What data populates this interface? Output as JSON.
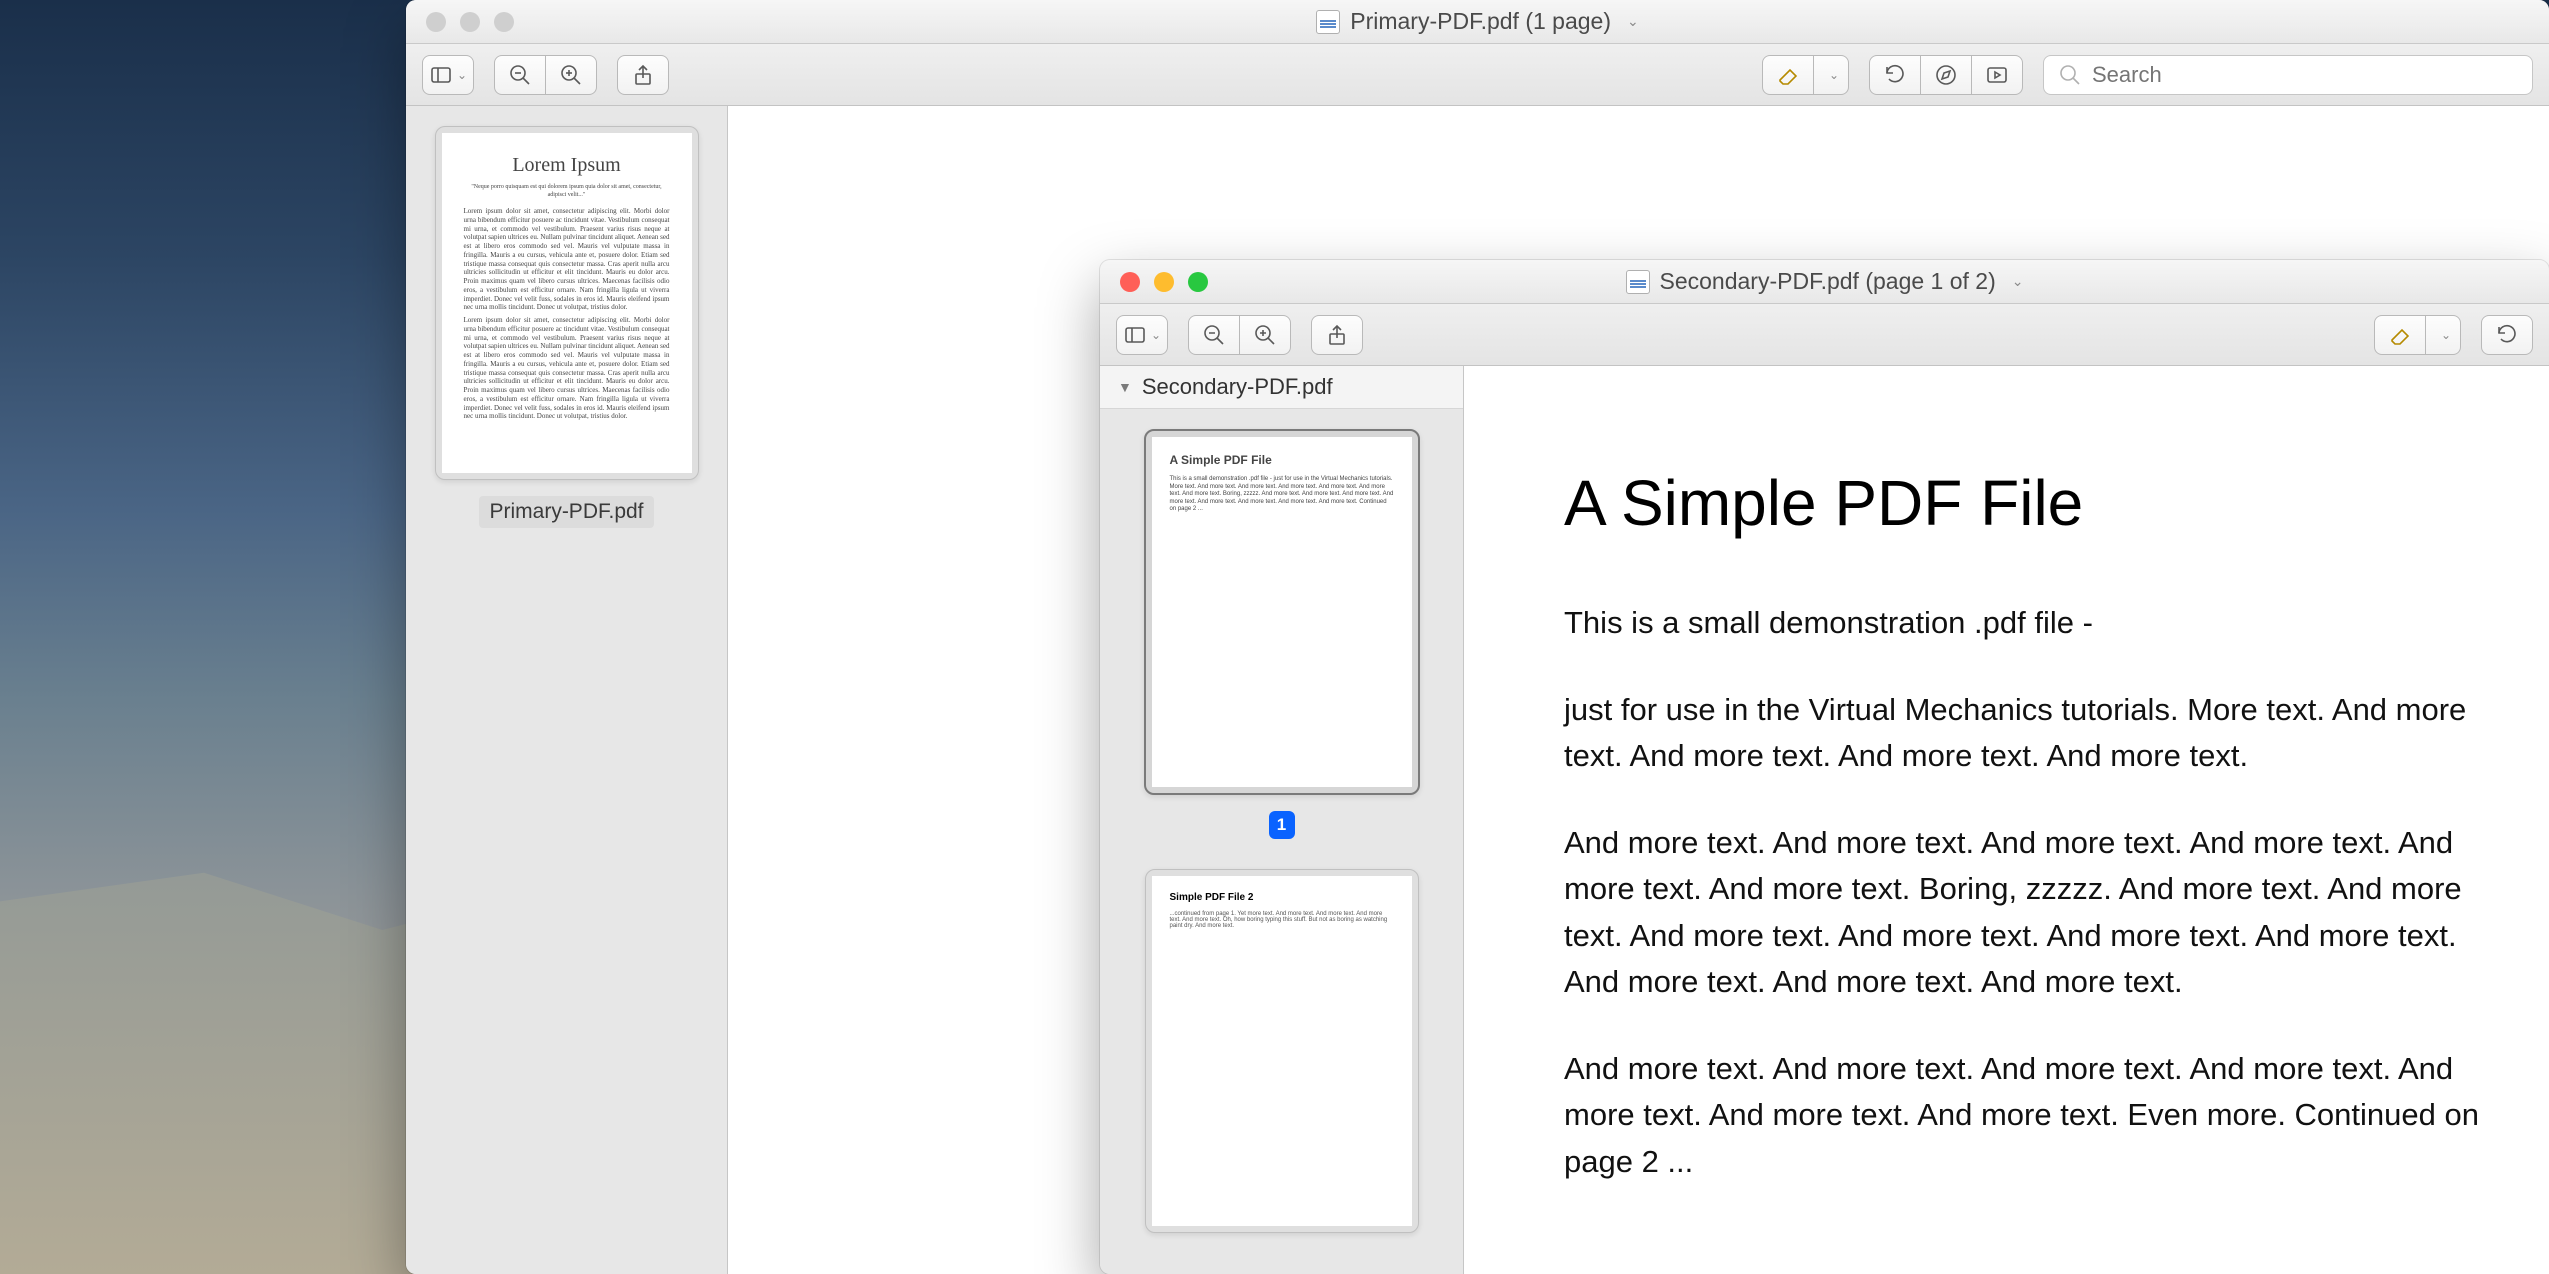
{
  "windows": {
    "primary": {
      "title": "Primary-PDF.pdf (1 page)",
      "search_placeholder": "Search",
      "sidebar": {
        "thumb_label": "Primary-PDF.pdf",
        "thumb_heading": "Lorem Ipsum",
        "thumb_tag": "\"Neque porro quisquam est qui dolorem ipsum quia dolor sit amet, consectetur, adipisci velit...\"",
        "thumb_body": "Lorem ipsum dolor sit amet, consectetur adipiscing elit. Morbi dolor urna bibendum efficitur posuere ac tincidunt vitae. Vestibulum consequat mi urna, et commodo vel vestibulum. Praesent varius risus neque at volutpat sapien ultrices eu. Nullam pulvinar tincidunt aliquet. Aenean sed est at libero eros commodo sed vel. Mauris vel vulputate massa in fringilla. Mauris a eu cursus, vehicula ante et, posuere dolor. Etiam sed tristique massa consequat quis consectetur massa. Cras aperit nulla arcu ultricies sollicitudin ut efficitur et elit tincidunt. Mauris eu dolor arcu. Proin maximus quam vel libero cursus ultrices. Maecenas facilisis odio eros, a vestibulum est efficitur ornare. Nam fringilla ligula ut viverra imperdiet. Donec vel velit fuss, sodales in eros id. Mauris eleifend ipsum nec urna mollis tincidunt. Donec ut volutpat, tristius dolor."
      }
    },
    "secondary": {
      "title": "Secondary-PDF.pdf (page 1 of 2)",
      "sidebar_header": "Secondary-PDF.pdf",
      "page_badge": "1",
      "thumb1_heading": "A Simple PDF File",
      "thumb1_body": "This is a small demonstration .pdf file - just for use in the Virtual Mechanics tutorials. More text. And more text. And more text. And more text. And more text. And more text. And more text. Boring, zzzzz. And more text. And more text. And more text. And more text. And more text. And more text. And more text. And more text. Continued on page 2 ...",
      "thumb2_heading": "Simple PDF File 2",
      "thumb2_body": "...continued from page 1. Yet more text. And more text. And more text. And more text. And more text. Oh, how boring typing this stuff. But not as boring as watching paint dry. And more text.",
      "document": {
        "heading": "A Simple PDF File",
        "p1": "This is a small demonstration .pdf file -",
        "p2": "just for use in the Virtual Mechanics tutorials. More text. And more text. And more text. And more text. And more text.",
        "p3": "And more text. And more text. And more text. And more text. And more text. And more text. Boring, zzzzz. And more text. And more text. And more text. And more text. And more text. And more text. And more text. And more text. And more text.",
        "p4": "And more text. And more text. And more text. And more text. And more text. And more text. And more text. Even more. Continued on page 2 ..."
      }
    }
  }
}
